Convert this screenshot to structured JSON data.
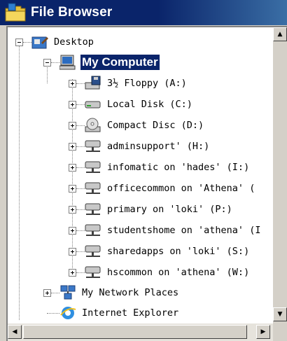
{
  "window": {
    "title": "File Browser"
  },
  "tree": {
    "desktop": "Desktop",
    "my_computer": "My Computer",
    "drives": [
      {
        "label": "3½ Floppy (A:)",
        "icon": "floppy-drive-icon"
      },
      {
        "label": "Local Disk (C:)",
        "icon": "hard-disk-icon"
      },
      {
        "label": "Compact Disc (D:)",
        "icon": "cd-drive-icon"
      },
      {
        "label": "adminsupport' (H:)",
        "icon": "network-drive-icon"
      },
      {
        "label": "infomatic on 'hades' (I:)",
        "icon": "network-drive-icon"
      },
      {
        "label": "officecommon on 'Athena' (",
        "icon": "network-drive-icon"
      },
      {
        "label": "primary on 'loki' (P:)",
        "icon": "network-drive-icon"
      },
      {
        "label": "studentshome on 'athena' (I",
        "icon": "network-drive-icon"
      },
      {
        "label": "sharedapps on 'loki' (S:)",
        "icon": "network-drive-icon"
      },
      {
        "label": "hscommon on 'athena' (W:)",
        "icon": "network-drive-icon"
      }
    ],
    "network_places": "My Network Places",
    "internet_explorer": "Internet Explorer"
  },
  "colors": {
    "title_bar": "#0a246a",
    "selection": "#0a246a",
    "face": "#d4d0c8"
  }
}
